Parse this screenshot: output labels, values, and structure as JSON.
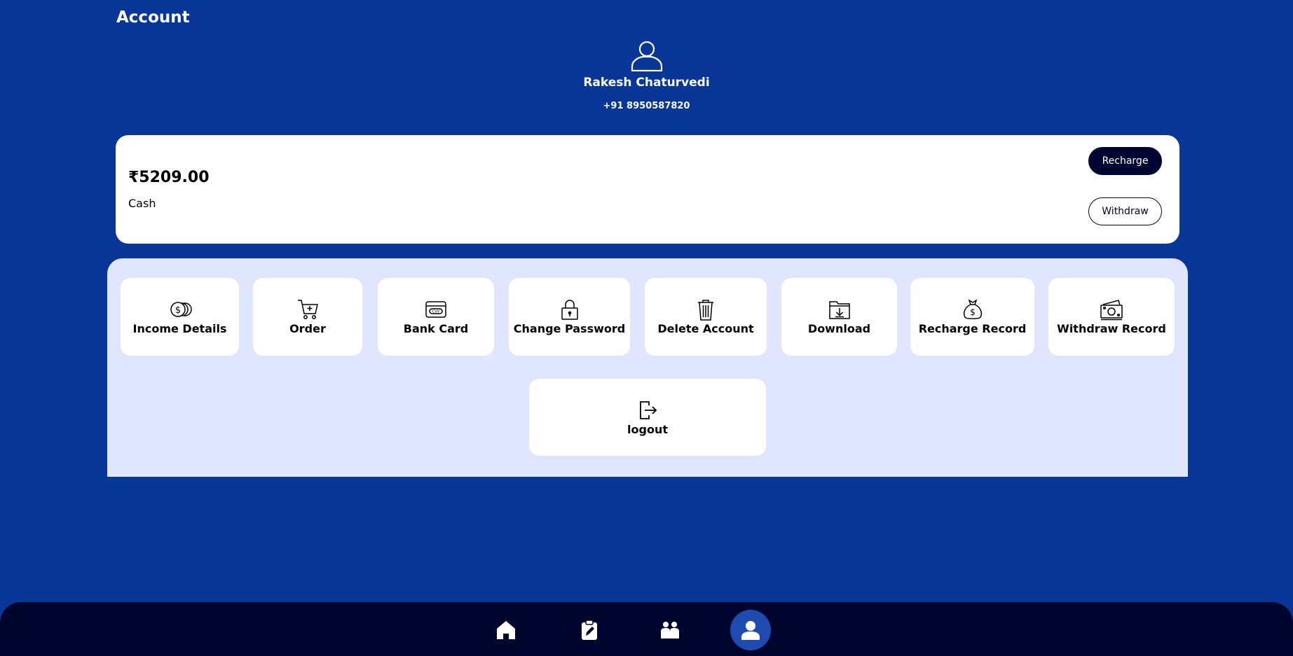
{
  "header": {
    "title": "Account"
  },
  "profile": {
    "avatar_icon": "user-outline-icon",
    "name": "Rakesh Chaturvedi",
    "phone": "+91 8950587820"
  },
  "balance": {
    "amount": "₹5209.00",
    "label": "Cash",
    "recharge_label": "Recharge",
    "withdraw_label": "Withdraw"
  },
  "menu": {
    "items": [
      {
        "label": "Income Details",
        "icon": "coins-icon"
      },
      {
        "label": "Order",
        "icon": "cart-icon"
      },
      {
        "label": "Bank Card",
        "icon": "card-icon"
      },
      {
        "label": "Change Password",
        "icon": "lock-icon"
      },
      {
        "label": "Delete Account",
        "icon": "trash-icon"
      },
      {
        "label": "Download",
        "icon": "download-folder-icon"
      },
      {
        "label": "Recharge Record",
        "icon": "money-bag-icon"
      },
      {
        "label": "Withdraw Record",
        "icon": "cash-stack-icon"
      },
      {
        "label": "logout",
        "icon": "logout-icon"
      }
    ]
  },
  "bottom_nav": {
    "items": [
      {
        "icon": "home-icon",
        "active": false
      },
      {
        "icon": "clipboard-edit-icon",
        "active": false
      },
      {
        "icon": "group-icon",
        "active": false
      },
      {
        "icon": "user-icon",
        "active": true
      }
    ]
  },
  "colors": {
    "background": "#083797",
    "panel": "#dfe6fe",
    "card": "#ffffff",
    "dark": "#000430",
    "nav_bg": "#00052e",
    "nav_active": "#1f4bb0"
  }
}
